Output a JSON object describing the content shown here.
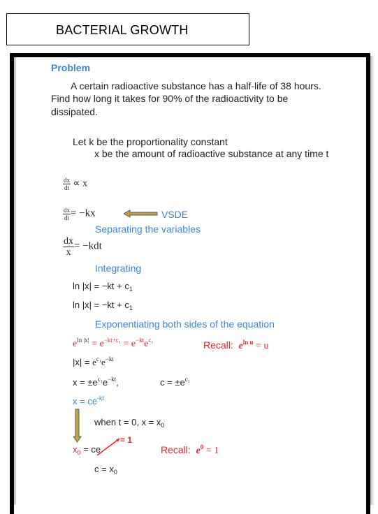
{
  "header": {
    "title": "BACTERIAL GROWTH"
  },
  "problem": {
    "heading": "Problem",
    "line1": "A certain radioactive substance has a half-life of 38 hours.",
    "line2": "Find how long it takes for 90% of the radioactivity to be",
    "line3": "dissipated."
  },
  "let": {
    "line1": "Let  k be the proportionality constant",
    "line2": "x be the amount of radioactive substance at any time t"
  },
  "steps": {
    "prop_num": "dx",
    "prop_den": "dt",
    "prop_rhs": "∝  x",
    "vsde_num": "dx",
    "vsde_den": "dt",
    "vsde_rhs": "= −kx",
    "vsde_label": "VSDE",
    "separating": "Separating the variables",
    "sep_num": "dx",
    "sep_den": "x",
    "sep_rhs": "= −kdt",
    "integrating": "Integrating",
    "ln1": "ln |x| = −kt + c",
    "ln1_sub": "1",
    "ln2": "ln |x| = −kt + c",
    "ln2_sub": "1",
    "exponentiating": "Exponentiating both sides of the equation",
    "exp_e1": "e",
    "exp_sup1": "ln |x|",
    "exp_eq1": " = e",
    "exp_sup2": "−kt+c₁",
    "exp_eq2": " = e",
    "exp_sup3": "−kt",
    "exp_e3": "e",
    "exp_sup4": "c₁",
    "recall1_label": "Recall:",
    "recall1_e": "e",
    "recall1_sup": "ln u",
    "recall1_rhs": " = u",
    "abs_lhs": "|x| = ",
    "abs_e1": "e",
    "abs_sup1": "c₁",
    "abs_e2": "e",
    "abs_sup2": "−kt",
    "pm_lhs": "x = ±e",
    "pm_sup1": "c₁",
    "pm_e2": "e",
    "pm_sup2": "−kt",
    "pm_comma": ",",
    "c_def": "c = ±e",
    "c_def_sup": "c₁",
    "general": "x = ce",
    "general_sup": "-kt",
    "when": "when t = 0,    x = x",
    "when_sub": "0",
    "x0_lhs": "x",
    "x0_sub": "0",
    "x0_rhs": " = ce",
    "cross_label": "= 1",
    "recall2_label": "Recall:",
    "recall2_e": "e",
    "recall2_sup": "0",
    "recall2_rhs": " = 1",
    "c_result": "c = x",
    "c_result_sub": "0"
  },
  "colors": {
    "accent_blue": "#3a86d4",
    "accent_red": "#e4232a",
    "arrow_gold": "#c9a227"
  }
}
